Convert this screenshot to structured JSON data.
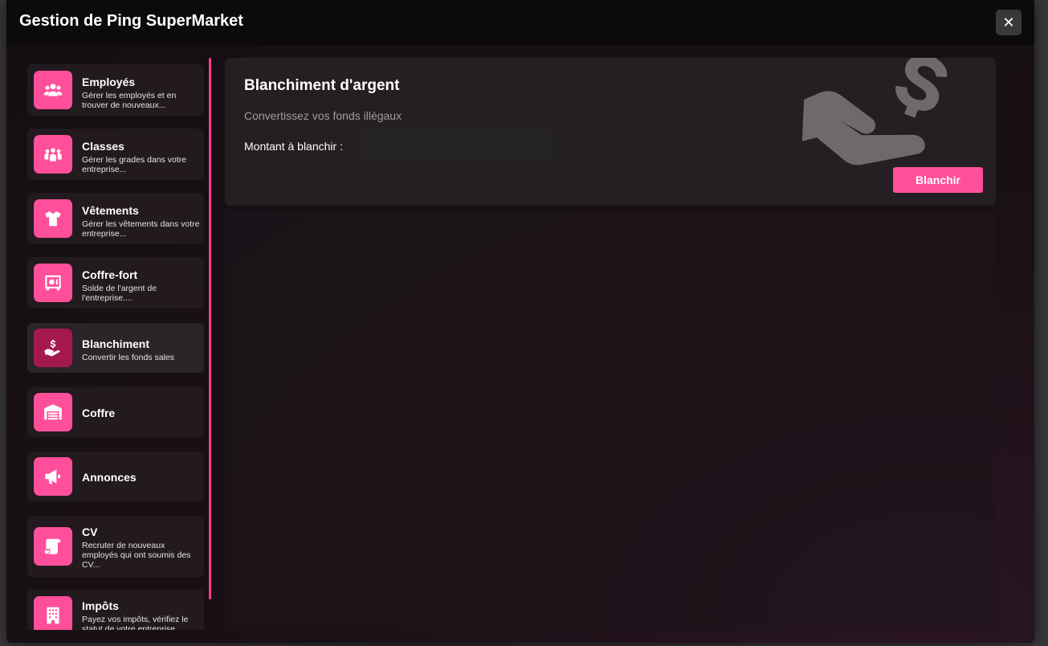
{
  "window": {
    "title": "Gestion de Ping SuperMarket",
    "close_label": "✕"
  },
  "sidebar": {
    "items": [
      {
        "title": "Employés",
        "desc": "Gérer les employés et en trouver de nouveaux...",
        "icon": "users-icon"
      },
      {
        "title": "Classes",
        "desc": "Gérer les grades dans votre entreprise...",
        "icon": "group-icon"
      },
      {
        "title": "Vêtements",
        "desc": "Gérer les vêtements dans votre entreprise...",
        "icon": "tshirt-icon"
      },
      {
        "title": "Coffre-fort",
        "desc": "Solde de l'argent de l'entreprise....",
        "icon": "safe-icon"
      },
      {
        "title": "Blanchiment",
        "desc": "Convertir les fonds sales",
        "icon": "hand-dollar-icon",
        "active": true
      },
      {
        "title": "Coffre",
        "desc": "",
        "icon": "warehouse-icon"
      },
      {
        "title": "Annonces",
        "desc": "",
        "icon": "megaphone-icon"
      },
      {
        "title": "CV",
        "desc": "Recruter de nouveaux employés qui ont soumis des CV...",
        "icon": "scroll-icon"
      },
      {
        "title": "Impôts",
        "desc": "Payez vos impôts, vérifiez le statut de votre entreprise...",
        "icon": "building-icon"
      }
    ]
  },
  "laundering": {
    "title": "Blanchiment d'argent",
    "subtitle": "Convertissez vos fonds illégaux",
    "amount_label": "Montant à blanchir :",
    "amount_value": "",
    "button_label": "Blanchir"
  },
  "colors": {
    "accent": "#ff4f9a",
    "active_icon": "#a3194f"
  }
}
